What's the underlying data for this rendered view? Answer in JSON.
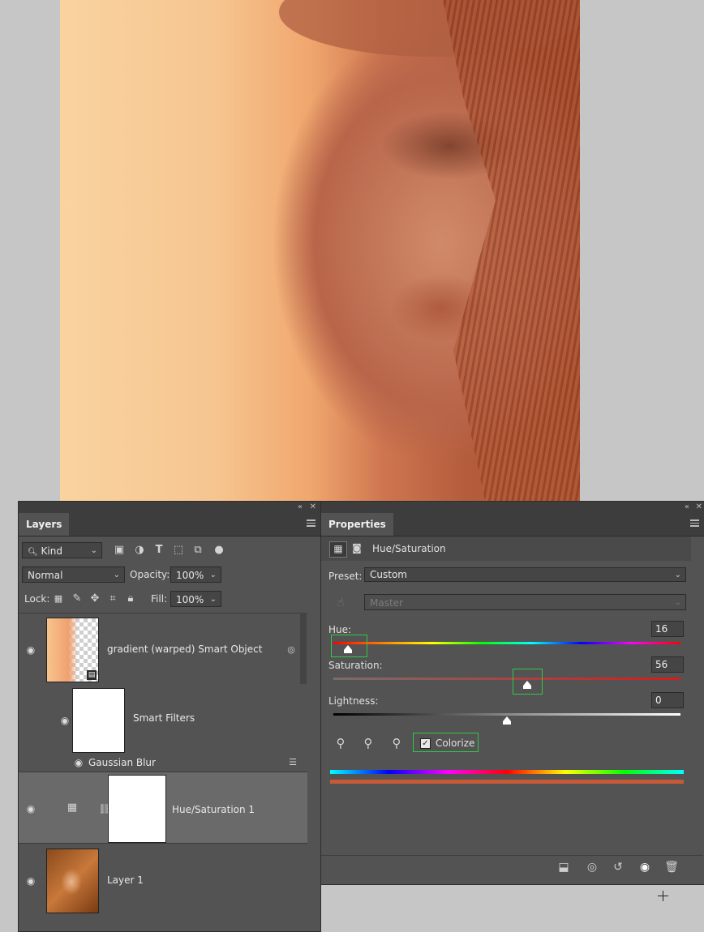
{
  "layers_panel": {
    "tab": "Layers",
    "filter_kind": "Kind",
    "blend_mode": "Normal",
    "opacity_label": "Opacity:",
    "opacity_value": "100%",
    "lock_label": "Lock:",
    "fill_label": "Fill:",
    "fill_value": "100%",
    "layers": [
      {
        "name": "gradient (warped) Smart Object"
      },
      {
        "name": "Smart Filters"
      },
      {
        "name": "Gaussian Blur"
      },
      {
        "name": "Hue/Saturation 1"
      },
      {
        "name": "Layer 1"
      }
    ]
  },
  "properties_panel": {
    "tab": "Properties",
    "adjustment_title": "Hue/Saturation",
    "preset_label": "Preset:",
    "preset_value": "Custom",
    "channel_value": "Master",
    "hue_label": "Hue:",
    "hue_value": "16",
    "saturation_label": "Saturation:",
    "saturation_value": "56",
    "lightness_label": "Lightness:",
    "lightness_value": "0",
    "colorize_label": "Colorize",
    "colorize_checked": true
  },
  "colors": {
    "panel_bg": "#535353",
    "highlight": "#34c748",
    "colorize_bar": "#c65a36"
  }
}
